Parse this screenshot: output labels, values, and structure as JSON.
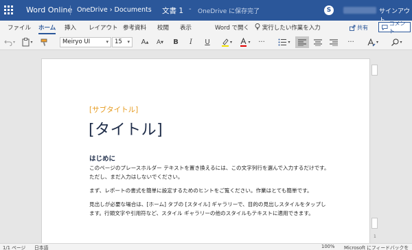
{
  "titlebar": {
    "app_name": "Word Online",
    "breadcrumb_root": "OneDrive",
    "breadcrumb_sep": "›",
    "breadcrumb_folder": "Documents",
    "doc_title": "文書 1",
    "dash": "-",
    "save_status": "OneDrive に保存完了",
    "skype_icon": "S",
    "sign_out": "サインアウト"
  },
  "ribbon": {
    "tabs": [
      "ファイル",
      "ホーム",
      "挿入",
      "レイアウト",
      "参考資料",
      "校閲",
      "表示"
    ],
    "active_tab": "ホーム",
    "open_in_word": "Word で開く",
    "tell_me": "実行したい作業を入力",
    "share": "共有",
    "comment": "コメント"
  },
  "toolbar": {
    "font_name": "Meiryo UI",
    "font_size": "15",
    "grow_font": "A",
    "shrink_font": "A",
    "bold": "B",
    "italic": "I",
    "underline": "U",
    "more": "···",
    "highlight_color": "#f2e000",
    "font_color": "#e00000"
  },
  "document": {
    "subtitle": "[サブタイトル]",
    "title": "[タイトル]",
    "heading": "はじめに",
    "paragraphs": [
      "このページのプレースホルダー テキストを置き換えるには、この文字列行を選んで入力するだけです。ただし、まだ入力はしないでください。",
      "まず、レポートの書式を簡単に設定するためのヒントをご覧ください。作業はとても簡単です。",
      "見出しが必要な場合は、[ホーム] タブの [スタイル] ギャラリーで、目的の見出しスタイルをタップします。行頭文字や引用符など、スタイル ギャラリーの他のスタイルもテキストに適用できます。"
    ],
    "page_number": "1"
  },
  "statusbar": {
    "page": "1/1 ページ",
    "language": "日本語",
    "zoom": "100%",
    "feedback": "Microsoft にフィードバックを送信"
  },
  "colors": {
    "brand": "#2b579a",
    "subtitle": "#e69b1f",
    "title": "#1f2d49"
  }
}
